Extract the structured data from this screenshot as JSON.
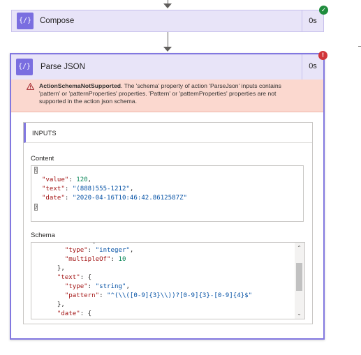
{
  "compose": {
    "title": "Compose",
    "duration": "0s",
    "icon": "expression-braces-icon",
    "status": "succeeded",
    "status_color": "#1f8c3d"
  },
  "parse_json": {
    "title": "Parse JSON",
    "duration": "0s",
    "icon": "expression-braces-icon",
    "status": "failed",
    "status_color": "#d13438",
    "error": {
      "code": "ActionSchemaNotSupported",
      "message_line1": ". The 'schema' property of action 'ParseJson' inputs contains",
      "message_line2": "'pattern' or 'patternProperties' properties. 'Pattern' or 'patternProperties' properties are not",
      "message_line3": "supported in the action json schema."
    },
    "inputs": {
      "header": "INPUTS",
      "content_label": "Content",
      "schema_label": "Schema"
    }
  },
  "colors": {
    "accent": "#8278e0",
    "card_header_bg": "#e8e4f8",
    "error_bg": "#fbd8cf"
  }
}
